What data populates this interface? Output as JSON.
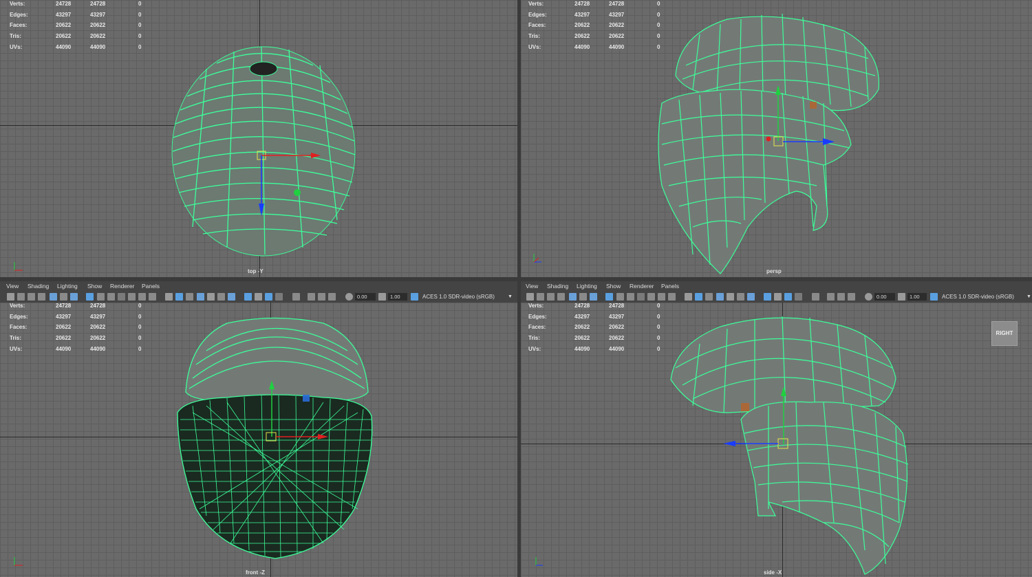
{
  "menu": [
    "View",
    "Shading",
    "Lighting",
    "Show",
    "Renderer",
    "Panels"
  ],
  "toolbar": {
    "exposure": "0.00",
    "gamma": "1.00",
    "colorspace": "ACES 1.0 SDR-video (sRGB)"
  },
  "stats": [
    {
      "label": "Verts:",
      "a": "24728",
      "b": "24728",
      "c": "0"
    },
    {
      "label": "Edges:",
      "a": "43297",
      "b": "43297",
      "c": "0"
    },
    {
      "label": "Faces:",
      "a": "20622",
      "b": "20622",
      "c": "0"
    },
    {
      "label": "Tris:",
      "a": "20622",
      "b": "20622",
      "c": "0"
    },
    {
      "label": "UVs:",
      "a": "44090",
      "b": "44090",
      "c": "0"
    }
  ],
  "viewports": {
    "top": {
      "camera": "top -Y"
    },
    "persp": {
      "camera": "persp"
    },
    "front": {
      "camera": "front -Z"
    },
    "side": {
      "camera": "side -X"
    }
  },
  "viewcube": {
    "label": "RIGHT"
  },
  "icons": {
    "mesh": "wireframe-mesh",
    "manipulator": "move-manipulator-icon",
    "axis": "axis-indicator-icon"
  },
  "colors": {
    "wire": "#3cff9a",
    "viewport_bg": "#6a6a6a",
    "x_axis": "#e02020",
    "y_axis": "#20d040",
    "z_axis": "#1a3cff"
  }
}
